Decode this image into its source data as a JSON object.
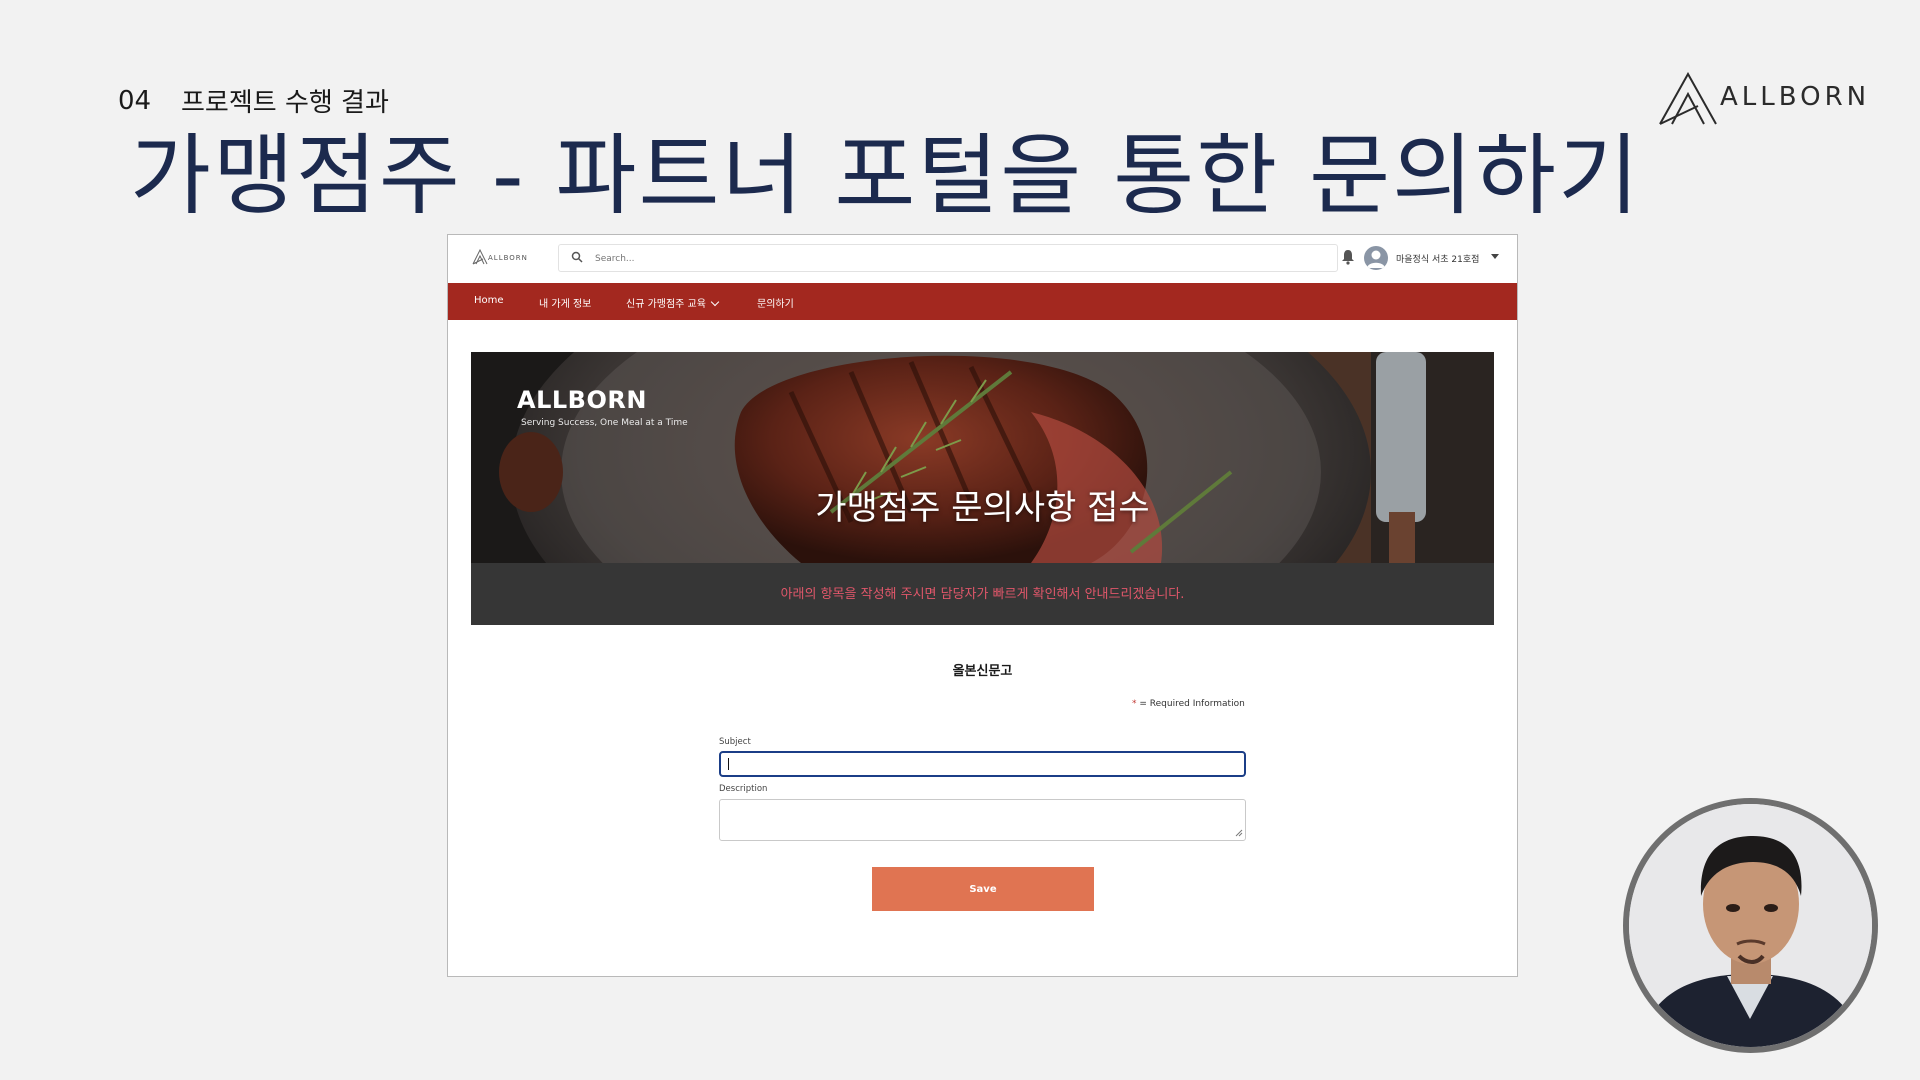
{
  "slide": {
    "number": "04",
    "section": "프로젝트 수행 결과",
    "title": "가맹점주 - 파트너 포털을 통한 문의하기",
    "brand": "ALLBORN"
  },
  "portal": {
    "logo_text": "ALLBORN",
    "search_placeholder": "Search...",
    "user_name": "마을정식 서초 21호점",
    "nav": [
      {
        "label": "Home"
      },
      {
        "label": "내 가게 정보"
      },
      {
        "label": "신규 가맹점주 교육"
      },
      {
        "label": "문의하기"
      }
    ],
    "banner": {
      "brand": "ALLBORN",
      "tagline": "Serving Success, One Meal at a Time",
      "title": "가맹점주 문의사항 접수",
      "message": "아래의 항목을 작성해 주시면 담당자가 빠르게 확인해서 안내드리겠습니다."
    },
    "form": {
      "title": "올본신문고",
      "required_star": "*",
      "required_note": "= Required Information",
      "subject_label": "Subject",
      "subject_value": "",
      "description_label": "Description",
      "description_value": "",
      "save_label": "Save"
    }
  },
  "colors": {
    "title": "#1c2a4e",
    "nav_bg": "#a3281f",
    "save_button": "#e07452",
    "banner_message": "#e0576a"
  }
}
